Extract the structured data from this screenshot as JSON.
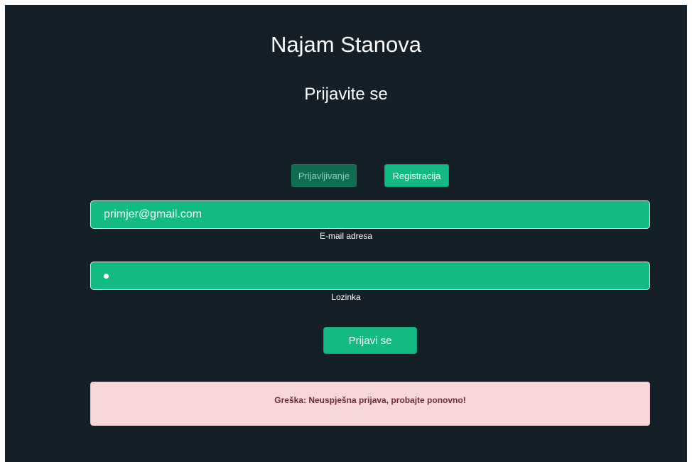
{
  "app": {
    "title": "Najam Stanova",
    "subtitle": "Prijavite se"
  },
  "tabs": {
    "login": "Prijavljivanje",
    "register": "Registracija"
  },
  "form": {
    "email_value": "primjer@gmail.com",
    "email_label": "E-mail adresa",
    "password_label": "Lozinka",
    "submit_label": "Prijavi se"
  },
  "alert": {
    "message": "Greška: Neuspješna prijava, probajte ponovno!"
  },
  "colors": {
    "background": "#151f28",
    "accent": "#14ba83",
    "active_tab": "#0f6e52",
    "alert_background": "#f8d7da",
    "alert_text": "#722a31"
  }
}
